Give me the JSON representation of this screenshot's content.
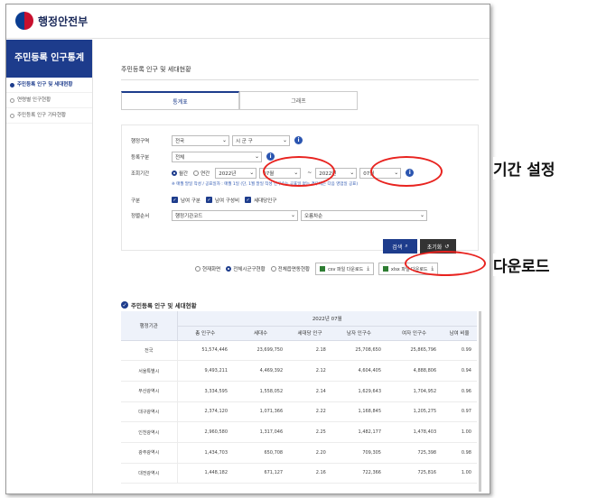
{
  "app": {
    "logo_text": "행정안전부"
  },
  "sidebar": {
    "title": "주민등록 인구통계",
    "items": [
      {
        "label": "주민등록 인구 및 세대현황"
      },
      {
        "label": "연령별 인구현황"
      },
      {
        "label": "주민등록 인구 기타현황"
      }
    ]
  },
  "main": {
    "page_title": "주민등록 인구 및 세대현황",
    "tabs": [
      {
        "label": "통계표"
      },
      {
        "label": "그래프"
      }
    ]
  },
  "filter": {
    "region_label": "행정구역",
    "region_sido": "전국",
    "region_sigungu": "시 군 구",
    "reg_type_label": "등록구분",
    "reg_type_value": "전체",
    "period_label": "조회기간",
    "period_monthly": "월간",
    "period_yearly": "연간",
    "start_year": "2022년",
    "start_month": "07월",
    "dash": "~",
    "end_year": "2022년",
    "end_month": "07월",
    "note": "※ 매월 말일 작성 / 공표일자 : 매월 1일 (단, 1월 말일 작성 인구수는 공표일 없는 경우에는 다음 영업일 공표)",
    "gubun_label": "구분",
    "check_gender": "남여 구분",
    "check_ratio": "남여 구성비",
    "check_household": "세대당인구",
    "sort_label": "정렬순서",
    "sort_value": "행정기관코드",
    "sort_order": "오름차순"
  },
  "actions": {
    "search": "검색",
    "reset": "초기화",
    "scope_current": "현재화면",
    "scope_sigungu": "전체시군구현황",
    "scope_eupmyeon": "전체읍면동현황",
    "csv": "csv 파일 다운로드",
    "xlsx": "xlsx 파일 다운로드"
  },
  "table": {
    "section_title": "주민등록 인구 및 세대현황",
    "region_header": "행정기관",
    "period_header": "2022년 07월",
    "columns": [
      "총 인구수",
      "세대수",
      "세대당 인구",
      "남자 인구수",
      "여자 인구수",
      "남여 비율"
    ],
    "rows": [
      {
        "region": "전국",
        "values": [
          "51,574,446",
          "23,699,750",
          "2.18",
          "25,708,650",
          "25,865,796",
          "0.99"
        ]
      },
      {
        "region": "서울특별시",
        "values": [
          "9,493,211",
          "4,469,392",
          "2.12",
          "4,604,405",
          "4,888,806",
          "0.94"
        ]
      },
      {
        "region": "부산광역시",
        "values": [
          "3,334,595",
          "1,558,052",
          "2.14",
          "1,629,643",
          "1,704,952",
          "0.96"
        ]
      },
      {
        "region": "대구광역시",
        "values": [
          "2,374,120",
          "1,071,366",
          "2.22",
          "1,168,845",
          "1,205,275",
          "0.97"
        ]
      },
      {
        "region": "인천광역시",
        "values": [
          "2,960,580",
          "1,317,046",
          "2.25",
          "1,482,177",
          "1,478,403",
          "1.00"
        ]
      },
      {
        "region": "광주광역시",
        "values": [
          "1,434,703",
          "650,708",
          "2.20",
          "709,305",
          "725,398",
          "0.98"
        ]
      },
      {
        "region": "대전광역시",
        "values": [
          "1,448,182",
          "671,127",
          "2.16",
          "722,366",
          "725,816",
          "1.00"
        ]
      }
    ]
  },
  "annotations": {
    "period": "기간 설정",
    "download": "다운로드"
  },
  "colors": {
    "primary": "#1d3c8c",
    "highlight": "#e8231f"
  }
}
